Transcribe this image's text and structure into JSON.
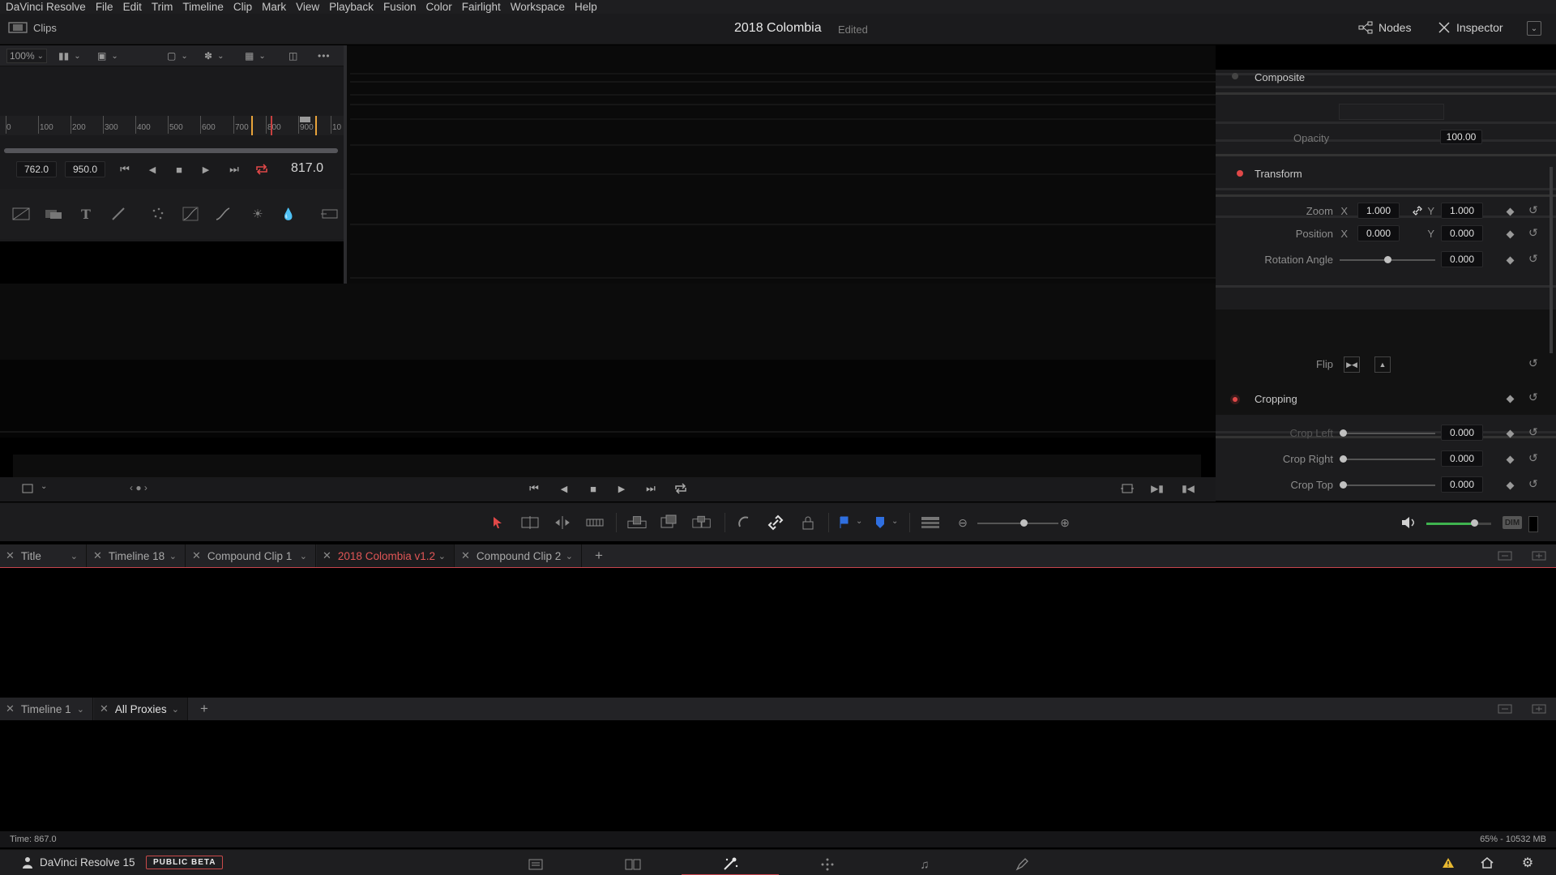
{
  "menu": [
    "DaVinci Resolve",
    "File",
    "Edit",
    "Trim",
    "Timeline",
    "Clip",
    "Mark",
    "View",
    "Playback",
    "Fusion",
    "Color",
    "Fairlight",
    "Workspace",
    "Help"
  ],
  "header": {
    "clips_label": "Clips",
    "project_title": "2018 Colombia",
    "project_status": "Edited",
    "nodes_label": "Nodes",
    "inspector_label": "Inspector"
  },
  "viewer": {
    "zoom": "100%",
    "ruler_labels": [
      "0",
      "100",
      "200",
      "300",
      "400",
      "500",
      "600",
      "700",
      "800",
      "900",
      "10"
    ],
    "in_point": "762.0",
    "out_point": "950.0",
    "current_frame": "817.0"
  },
  "inspector": {
    "sections": {
      "composite": "Composite",
      "transform": "Transform",
      "cropping": "Cropping"
    },
    "opacity_label": "Opacity",
    "opacity_value": "100.00",
    "zoom_label": "Zoom",
    "zoom_x": "1.000",
    "zoom_y": "1.000",
    "position_label": "Position",
    "position_x": "0.000",
    "position_y": "0.000",
    "x_label": "X",
    "y_label": "Y",
    "rotation_label": "Rotation Angle",
    "rotation_value": "0.000",
    "flip_label": "Flip",
    "crop_left_label": "Crop Left",
    "crop_left_value": "0.000",
    "crop_right_label": "Crop Right",
    "crop_right_value": "0.000",
    "crop_top_label": "Crop Top",
    "crop_top_value": "0.000"
  },
  "toolbar": {
    "dim_label": "DIM",
    "volume_level": 0.75,
    "zoom_level": 0.5
  },
  "timeline_tabs_top": [
    {
      "label": "Title",
      "active": false
    },
    {
      "label": "Timeline 18",
      "active": false
    },
    {
      "label": "Compound Clip 1",
      "active": false
    },
    {
      "label": "2018 Colombia v1.2",
      "active": true
    },
    {
      "label": "Compound Clip 2",
      "active": false
    }
  ],
  "timeline_tabs_bottom": [
    {
      "label": "Timeline 1",
      "active": false
    },
    {
      "label": "All Proxies",
      "active": true
    }
  ],
  "status": {
    "time": "Time: 867.0",
    "memory": "65% - 10532 MB"
  },
  "footer": {
    "app_name": "DaVinci Resolve 15",
    "beta_badge": "PUBLIC BETA"
  },
  "colors": {
    "accent_red": "#e04848",
    "active_tab_text": "#e05656",
    "volume_green": "#3fb34f",
    "playhead_orange": "#e8a33a"
  }
}
